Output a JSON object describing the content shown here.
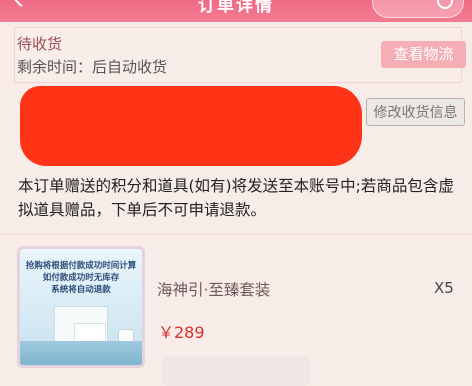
{
  "header": {
    "title": "订单详情"
  },
  "order_status": {
    "status": "待收货",
    "remaining_label": "剩余时间：后自动收货",
    "logistics_button": "查看物流"
  },
  "address": {
    "modify_button": "修改收货信息"
  },
  "notice": "本订单赠送的积分和道具(如有)将发送至本账号中;若商品包含虚拟道具赠品，下单后不可申请退款。",
  "product": {
    "thumb_line1": "抢购将根据付款成功时间计算",
    "thumb_line2": "如付款成功时无库存",
    "thumb_line3": "系统将自动退款",
    "name": "海神引·至臻套装",
    "quantity": "X5",
    "price": "￥289"
  },
  "colors": {
    "header": "#f06a85",
    "background": "#f7ece8",
    "logistics_button": "#f5aeb4",
    "price": "#d8312b",
    "redaction": "#ff3417"
  }
}
